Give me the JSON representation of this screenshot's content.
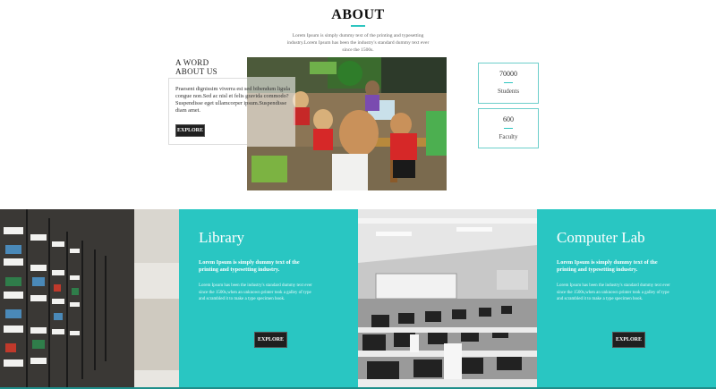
{
  "about": {
    "title": "ABOUT",
    "intro": "Lorem Ipsum is simply dummy text of the printing and typesetting industry.Lorem Ipsum has been the industry's standard dummy text ever since the 1500s."
  },
  "word_about": {
    "title_line1": "A WORD",
    "title_line2": "ABOUT US",
    "text": "Praesent dignissim viverra est sed bibendum ligula congue non.Sed ac nisl et felis gravida commodo? Suspendisse eget ullamcorper ipsum.Suspendisse diam amet.",
    "button": "EXPLORE"
  },
  "stats": [
    {
      "value": "70000",
      "label": "Students"
    },
    {
      "value": "600",
      "label": "Faculty"
    }
  ],
  "facilities": [
    {
      "title": "Library",
      "subtitle": "Lorem Ipsum is simply dummy text of the printing and typesetting industry.",
      "body": "Lorem Ipsum has been the industry's standard dummy text ever since the 1500s,when an unknown printer took a galley of type and scrambled it to make a type specimen book.",
      "button": "EXPLORE"
    },
    {
      "title": "Computer Lab",
      "subtitle": "Lorem Ipsum is simply dummy text of the printing and typesetting industry.",
      "body": "Lorem Ipsum has been the industry's standard dummy text ever since the 1500s,when an unknown printer took a galley of type and scrambled it to make a type specimen book.",
      "button": "EXPLORE"
    }
  ],
  "colors": {
    "accent": "#29c6c2",
    "button": "#1f1f1f"
  }
}
